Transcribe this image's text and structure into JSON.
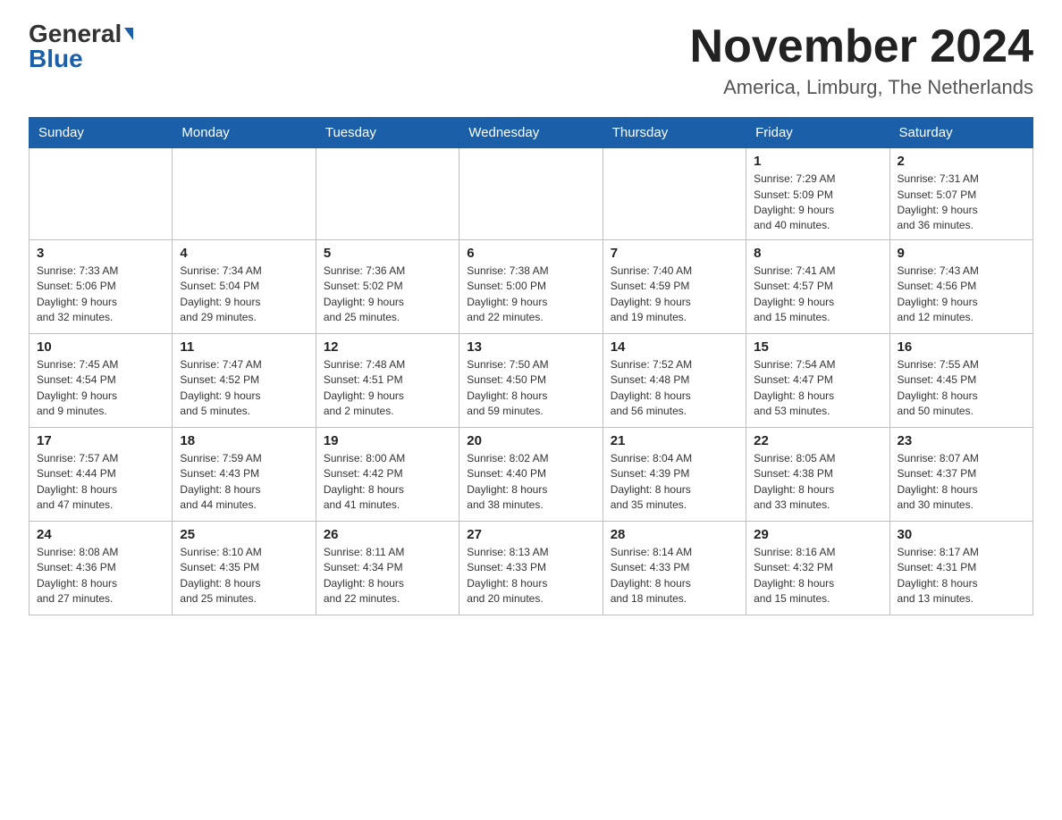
{
  "header": {
    "logo_general": "General",
    "logo_blue": "Blue",
    "month_title": "November 2024",
    "location": "America, Limburg, The Netherlands"
  },
  "weekdays": [
    "Sunday",
    "Monday",
    "Tuesday",
    "Wednesday",
    "Thursday",
    "Friday",
    "Saturday"
  ],
  "weeks": [
    [
      {
        "day": "",
        "info": ""
      },
      {
        "day": "",
        "info": ""
      },
      {
        "day": "",
        "info": ""
      },
      {
        "day": "",
        "info": ""
      },
      {
        "day": "",
        "info": ""
      },
      {
        "day": "1",
        "info": "Sunrise: 7:29 AM\nSunset: 5:09 PM\nDaylight: 9 hours\nand 40 minutes."
      },
      {
        "day": "2",
        "info": "Sunrise: 7:31 AM\nSunset: 5:07 PM\nDaylight: 9 hours\nand 36 minutes."
      }
    ],
    [
      {
        "day": "3",
        "info": "Sunrise: 7:33 AM\nSunset: 5:06 PM\nDaylight: 9 hours\nand 32 minutes."
      },
      {
        "day": "4",
        "info": "Sunrise: 7:34 AM\nSunset: 5:04 PM\nDaylight: 9 hours\nand 29 minutes."
      },
      {
        "day": "5",
        "info": "Sunrise: 7:36 AM\nSunset: 5:02 PM\nDaylight: 9 hours\nand 25 minutes."
      },
      {
        "day": "6",
        "info": "Sunrise: 7:38 AM\nSunset: 5:00 PM\nDaylight: 9 hours\nand 22 minutes."
      },
      {
        "day": "7",
        "info": "Sunrise: 7:40 AM\nSunset: 4:59 PM\nDaylight: 9 hours\nand 19 minutes."
      },
      {
        "day": "8",
        "info": "Sunrise: 7:41 AM\nSunset: 4:57 PM\nDaylight: 9 hours\nand 15 minutes."
      },
      {
        "day": "9",
        "info": "Sunrise: 7:43 AM\nSunset: 4:56 PM\nDaylight: 9 hours\nand 12 minutes."
      }
    ],
    [
      {
        "day": "10",
        "info": "Sunrise: 7:45 AM\nSunset: 4:54 PM\nDaylight: 9 hours\nand 9 minutes."
      },
      {
        "day": "11",
        "info": "Sunrise: 7:47 AM\nSunset: 4:52 PM\nDaylight: 9 hours\nand 5 minutes."
      },
      {
        "day": "12",
        "info": "Sunrise: 7:48 AM\nSunset: 4:51 PM\nDaylight: 9 hours\nand 2 minutes."
      },
      {
        "day": "13",
        "info": "Sunrise: 7:50 AM\nSunset: 4:50 PM\nDaylight: 8 hours\nand 59 minutes."
      },
      {
        "day": "14",
        "info": "Sunrise: 7:52 AM\nSunset: 4:48 PM\nDaylight: 8 hours\nand 56 minutes."
      },
      {
        "day": "15",
        "info": "Sunrise: 7:54 AM\nSunset: 4:47 PM\nDaylight: 8 hours\nand 53 minutes."
      },
      {
        "day": "16",
        "info": "Sunrise: 7:55 AM\nSunset: 4:45 PM\nDaylight: 8 hours\nand 50 minutes."
      }
    ],
    [
      {
        "day": "17",
        "info": "Sunrise: 7:57 AM\nSunset: 4:44 PM\nDaylight: 8 hours\nand 47 minutes."
      },
      {
        "day": "18",
        "info": "Sunrise: 7:59 AM\nSunset: 4:43 PM\nDaylight: 8 hours\nand 44 minutes."
      },
      {
        "day": "19",
        "info": "Sunrise: 8:00 AM\nSunset: 4:42 PM\nDaylight: 8 hours\nand 41 minutes."
      },
      {
        "day": "20",
        "info": "Sunrise: 8:02 AM\nSunset: 4:40 PM\nDaylight: 8 hours\nand 38 minutes."
      },
      {
        "day": "21",
        "info": "Sunrise: 8:04 AM\nSunset: 4:39 PM\nDaylight: 8 hours\nand 35 minutes."
      },
      {
        "day": "22",
        "info": "Sunrise: 8:05 AM\nSunset: 4:38 PM\nDaylight: 8 hours\nand 33 minutes."
      },
      {
        "day": "23",
        "info": "Sunrise: 8:07 AM\nSunset: 4:37 PM\nDaylight: 8 hours\nand 30 minutes."
      }
    ],
    [
      {
        "day": "24",
        "info": "Sunrise: 8:08 AM\nSunset: 4:36 PM\nDaylight: 8 hours\nand 27 minutes."
      },
      {
        "day": "25",
        "info": "Sunrise: 8:10 AM\nSunset: 4:35 PM\nDaylight: 8 hours\nand 25 minutes."
      },
      {
        "day": "26",
        "info": "Sunrise: 8:11 AM\nSunset: 4:34 PM\nDaylight: 8 hours\nand 22 minutes."
      },
      {
        "day": "27",
        "info": "Sunrise: 8:13 AM\nSunset: 4:33 PM\nDaylight: 8 hours\nand 20 minutes."
      },
      {
        "day": "28",
        "info": "Sunrise: 8:14 AM\nSunset: 4:33 PM\nDaylight: 8 hours\nand 18 minutes."
      },
      {
        "day": "29",
        "info": "Sunrise: 8:16 AM\nSunset: 4:32 PM\nDaylight: 8 hours\nand 15 minutes."
      },
      {
        "day": "30",
        "info": "Sunrise: 8:17 AM\nSunset: 4:31 PM\nDaylight: 8 hours\nand 13 minutes."
      }
    ]
  ]
}
